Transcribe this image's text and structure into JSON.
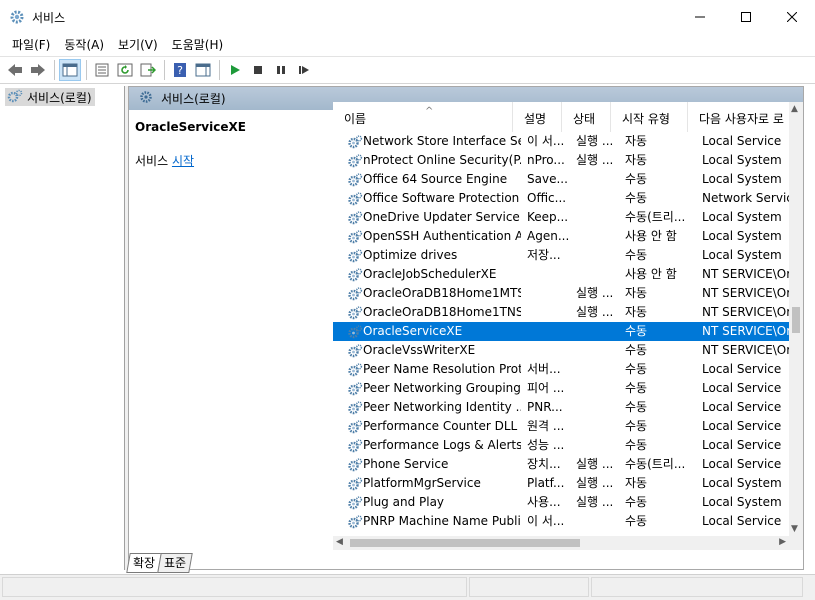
{
  "window": {
    "title": "서비스"
  },
  "menu": [
    "파일(F)",
    "동작(A)",
    "보기(V)",
    "도움말(H)"
  ],
  "tree": {
    "root_label": "서비스(로컬)"
  },
  "right_header": {
    "label": "서비스(로컬)"
  },
  "selected_service": {
    "name": "OracleServiceXE",
    "action_prefix": "서비스 ",
    "action_link": "시작"
  },
  "columns": [
    "이름",
    "설명",
    "상태",
    "시작 유형",
    "다음 사용자로 로"
  ],
  "rows": [
    {
      "name": "Network Store Interface Se...",
      "desc": "이 서...",
      "status": "실행 ...",
      "start": "자동",
      "logon": "Local Service"
    },
    {
      "name": "nProtect Online Security(P...",
      "desc": "nPro...",
      "status": "실행 ...",
      "start": "자동",
      "logon": "Local System"
    },
    {
      "name": "Office 64 Source Engine",
      "desc": "Save...",
      "status": "",
      "start": "수동",
      "logon": "Local System"
    },
    {
      "name": "Office Software Protection ...",
      "desc": "Offic...",
      "status": "",
      "start": "수동",
      "logon": "Network Service"
    },
    {
      "name": "OneDrive Updater Service",
      "desc": "Keep...",
      "status": "",
      "start": "수동(트리...",
      "logon": "Local System"
    },
    {
      "name": "OpenSSH Authentication A...",
      "desc": "Agen...",
      "status": "",
      "start": "사용 안 함",
      "logon": "Local System"
    },
    {
      "name": "Optimize drives",
      "desc": "저장...",
      "status": "",
      "start": "수동",
      "logon": "Local System"
    },
    {
      "name": "OracleJobSchedulerXE",
      "desc": "",
      "status": "",
      "start": "사용 안 함",
      "logon": "NT SERVICE\\Or"
    },
    {
      "name": "OracleOraDB18Home1MTS...",
      "desc": "",
      "status": "실행 ...",
      "start": "자동",
      "logon": "NT SERVICE\\Or"
    },
    {
      "name": "OracleOraDB18Home1TNS...",
      "desc": "",
      "status": "실행 ...",
      "start": "자동",
      "logon": "NT SERVICE\\Or"
    },
    {
      "name": "OracleServiceXE",
      "desc": "",
      "status": "",
      "start": "수동",
      "logon": "NT SERVICE\\Or",
      "selected": true
    },
    {
      "name": "OracleVssWriterXE",
      "desc": "",
      "status": "",
      "start": "수동",
      "logon": "NT SERVICE\\Or"
    },
    {
      "name": "Peer Name Resolution Prot...",
      "desc": "서버...",
      "status": "",
      "start": "수동",
      "logon": "Local Service"
    },
    {
      "name": "Peer Networking Grouping",
      "desc": "피어 ...",
      "status": "",
      "start": "수동",
      "logon": "Local Service"
    },
    {
      "name": "Peer Networking Identity ...",
      "desc": "PNR...",
      "status": "",
      "start": "수동",
      "logon": "Local Service"
    },
    {
      "name": "Performance Counter DLL ...",
      "desc": "원격 ...",
      "status": "",
      "start": "수동",
      "logon": "Local Service"
    },
    {
      "name": "Performance Logs & Alerts",
      "desc": "성능 ...",
      "status": "",
      "start": "수동",
      "logon": "Local Service"
    },
    {
      "name": "Phone Service",
      "desc": "장치...",
      "status": "실행 ...",
      "start": "수동(트리...",
      "logon": "Local Service"
    },
    {
      "name": "PlatformMgrService",
      "desc": "Platf...",
      "status": "실행 ...",
      "start": "자동",
      "logon": "Local System"
    },
    {
      "name": "Plug and Play",
      "desc": "사용...",
      "status": "실행 ...",
      "start": "수동",
      "logon": "Local System"
    },
    {
      "name": "PNRP Machine Name Publi...",
      "desc": "이 서...",
      "status": "",
      "start": "수동",
      "logon": "Local Service"
    }
  ],
  "tabs": [
    "확장",
    "표준"
  ]
}
